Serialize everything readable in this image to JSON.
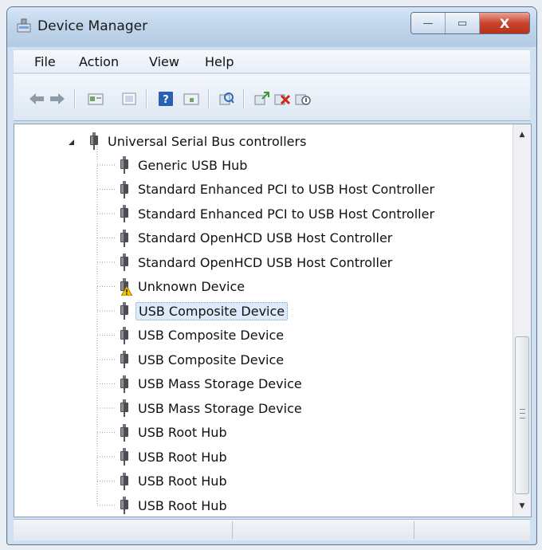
{
  "window": {
    "title": "Device Manager"
  },
  "title_buttons": {
    "minimize": "—",
    "maximize": "▭",
    "close": "X"
  },
  "menu": [
    "File",
    "Action",
    "View",
    "Help"
  ],
  "toolbar": [
    "back-arrow-icon",
    "forward-arrow-icon",
    "properties-icon",
    "show-hide-icon",
    "help-icon",
    "panel-icon",
    "scan-hardware-icon",
    "update-driver-icon",
    "uninstall-icon",
    "disable-device-icon"
  ],
  "tree": {
    "category": "Universal Serial Bus controllers",
    "devices": [
      "Generic USB Hub",
      "Standard Enhanced PCI to USB Host Controller",
      "Standard Enhanced PCI to USB Host Controller",
      "Standard OpenHCD USB Host Controller",
      "Standard OpenHCD USB Host Controller",
      "Unknown Device",
      "USB Composite Device",
      "USB Composite Device",
      "USB Composite Device",
      "USB Mass Storage Device",
      "USB Mass Storage Device",
      "USB Root Hub",
      "USB Root Hub",
      "USB Root Hub",
      "USB Root Hub"
    ],
    "warning_device": "Unknown Device",
    "selected_device": "USB Composite Device"
  },
  "colors": {
    "selection": "#ddeafa",
    "close_button": "#c8442c",
    "warning": "#f2c200"
  }
}
